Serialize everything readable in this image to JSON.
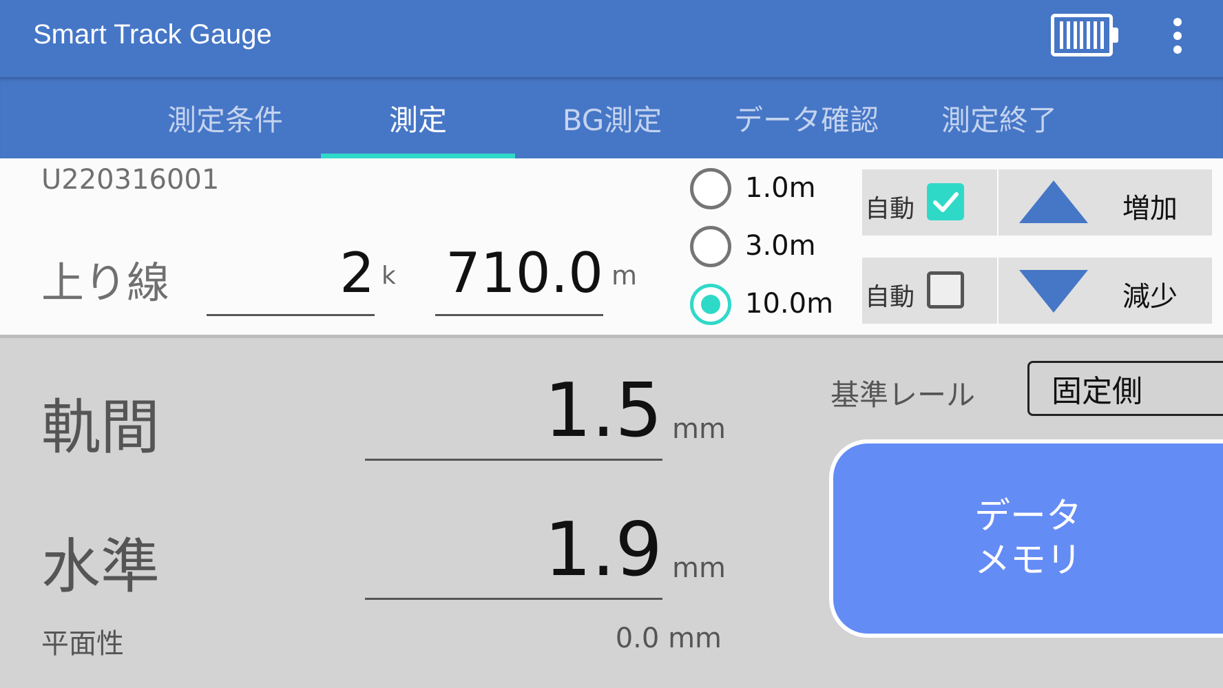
{
  "app": {
    "title": "Smart Track Gauge"
  },
  "tabs": [
    {
      "label": "測定条件",
      "active": false
    },
    {
      "label": "測定",
      "active": true
    },
    {
      "label": "BG測定",
      "active": false
    },
    {
      "label": "データ確認",
      "active": false
    },
    {
      "label": "測定終了",
      "active": false
    }
  ],
  "header": {
    "serial": "U220316001",
    "line_name": "上り線",
    "km_value": "2",
    "km_unit": "k",
    "m_value": "710.0",
    "m_unit": "m"
  },
  "interval": {
    "options": [
      {
        "label": "1.0m",
        "selected": false
      },
      {
        "label": "3.0m",
        "selected": false
      },
      {
        "label": "10.0m",
        "selected": true
      }
    ]
  },
  "auto_controls": [
    {
      "auto_label": "自動",
      "checked": true,
      "button_label": "増加",
      "direction": "up"
    },
    {
      "auto_label": "自動",
      "checked": false,
      "button_label": "減少",
      "direction": "down"
    }
  ],
  "measurements": {
    "gauge": {
      "label": "軌間",
      "value": "1.5",
      "unit": "mm"
    },
    "level": {
      "label": "水準",
      "value": "1.9",
      "unit": "mm"
    },
    "flatness": {
      "label": "平面性",
      "value": "0.0 mm"
    }
  },
  "reference_rail": {
    "label": "基準レール",
    "value": "固定側"
  },
  "memory_button": {
    "line1": "データ",
    "line2": "メモリ"
  },
  "colors": {
    "primary": "#4676c6",
    "accent": "#2fd9c8",
    "memory_button": "#648cf5"
  }
}
